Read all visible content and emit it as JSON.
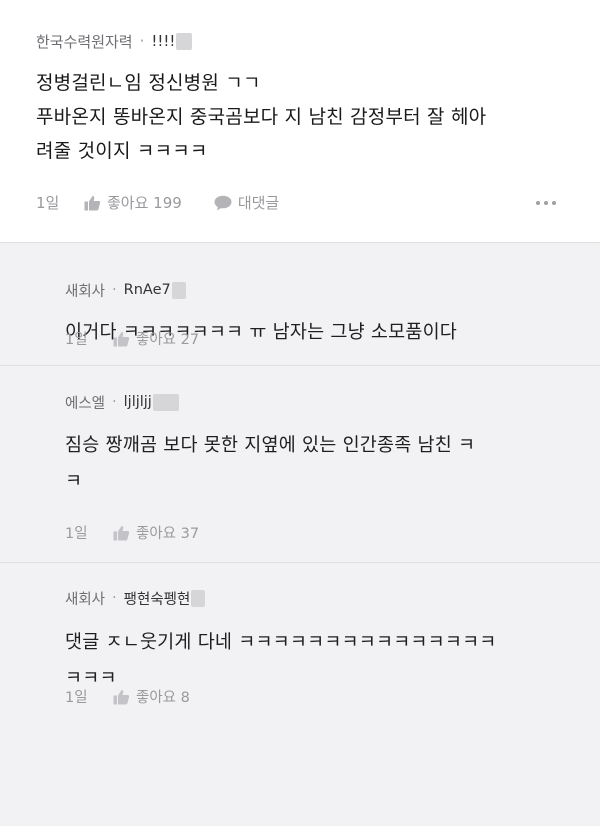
{
  "post": {
    "company": "한국수력원자력",
    "separator": "·",
    "nickname": "!!!!",
    "body": "정병걸린ㄴ임 정신병원 ㄱㄱ\n푸바온지 똥바온지 중국곰보다 지 남친 감정부터 잘 헤아\n려줄 것이지 ㅋㅋㅋㅋ",
    "time": "1일",
    "like_label": "좋아요 199",
    "reply_label": "대댓글"
  },
  "replies": [
    {
      "company": "새회사",
      "separator": "·",
      "nickname": "RnAe7",
      "body": "이거다 ㅋㅋㅋㅋㅋㅋㅋ ㅠ 남자는 그냥 소모품이다",
      "time": "1일",
      "like_label": "좋아요 27"
    },
    {
      "company": "에스엘",
      "separator": "·",
      "nickname": "ljljljj",
      "body": "짐승 짱깨곰 보다 못한 지옆에 있는 인간종족 남친 ㅋ\nㅋ",
      "time": "1일",
      "like_label": "좋아요 37"
    },
    {
      "company": "새회사",
      "separator": "·",
      "nickname": "팽현숙펭현",
      "body": "댓글 ㅈㄴ웃기게 다네 ㅋㅋㅋㅋㅋㅋㅋㅋㅋㅋㅋㅋㅋㅋㅋ\nㅋㅋㅋ",
      "time": "1일",
      "like_label": "좋아요 8"
    }
  ],
  "icons": {
    "like": "thumbs-up-icon",
    "reply": "speech-bubble-icon",
    "more": "more-dots-icon"
  },
  "colors": {
    "reply_background": "#f2f2f4",
    "post_background": "#ffffff",
    "muted_text": "#9a9a9e"
  }
}
